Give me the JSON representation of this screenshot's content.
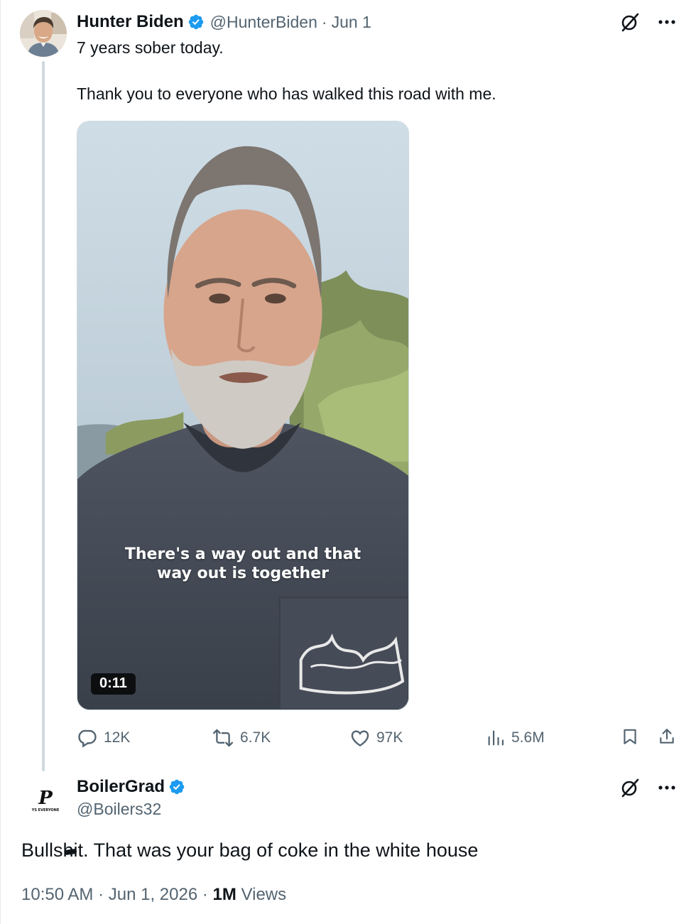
{
  "tweet": {
    "author_name": "Hunter Biden",
    "handle": "@HunterBiden",
    "separator": "·",
    "date": "Jun 1",
    "text_line1": "7 years sober today.",
    "text_line2": "Thank you to everyone who has walked this road with me.",
    "video": {
      "caption_line1": "There's a way out and that",
      "caption_line2": "way out is together",
      "duration": "0:11"
    },
    "stats": {
      "replies": "12K",
      "reposts": "6.7K",
      "likes": "97K",
      "views": "5.6M"
    }
  },
  "reply": {
    "author_name": "BoilerGrad",
    "handle": "@Boilers32",
    "text_before": "Bulls",
    "text_redacted": "hi",
    "text_after": "t. That was your bag of coke in the white house",
    "time": "10:50 AM",
    "separator": "·",
    "date": "Jun 1, 2026",
    "views_count": "1M",
    "views_label": "Views",
    "avatar_logo_text": "P",
    "avatar_tagline": "YS EVERYONE"
  },
  "icons": {
    "verified": "verified-badge-icon",
    "grok": "grok-icon",
    "more": "more-icon",
    "reply": "reply-icon",
    "repost": "repost-icon",
    "like": "like-icon",
    "views": "views-icon",
    "bookmark": "bookmark-icon",
    "share": "share-icon"
  },
  "colors": {
    "verified_blue": "#1d9bf0",
    "secondary_text": "#536471",
    "primary_text": "#0f1419",
    "thread_line": "#cfd9de"
  }
}
